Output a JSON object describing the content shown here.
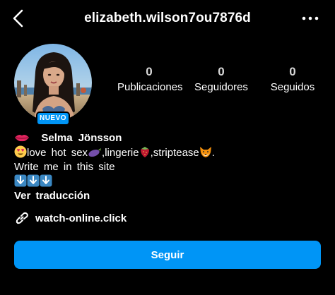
{
  "header": {
    "username": "elizabeth.wilson7ou7876d",
    "back_icon": "chevron-left-icon",
    "more_icon": "more-horizontal-icon"
  },
  "profile": {
    "badge_label": "NUEVO",
    "stats": [
      {
        "count": "0",
        "label": "Publicaciones"
      },
      {
        "count": "0",
        "label": "Seguidores"
      },
      {
        "count": "0",
        "label": "Seguidos"
      }
    ]
  },
  "bio": {
    "name": "Selma  Jönsson",
    "line1": "love  hot  sex",
    "line1_sep1": ",lingerie",
    "line1_sep2": ",striptease",
    "line1_end": ".",
    "line2": "Write  me  in  this  site",
    "translate_label": "Ver traducción",
    "emojis": [
      "lips-emoji",
      "heart-eyes-emoji",
      "eggplant-emoji",
      "strawberry-emoji",
      "fox-emoji",
      "down-arrow-emoji"
    ]
  },
  "link": {
    "icon": "link-icon",
    "text": "watch-online.click"
  },
  "actions": {
    "follow_label": "Seguir"
  },
  "colors": {
    "background": "#000000",
    "accent": "#0095f6",
    "text": "#ffffff"
  }
}
